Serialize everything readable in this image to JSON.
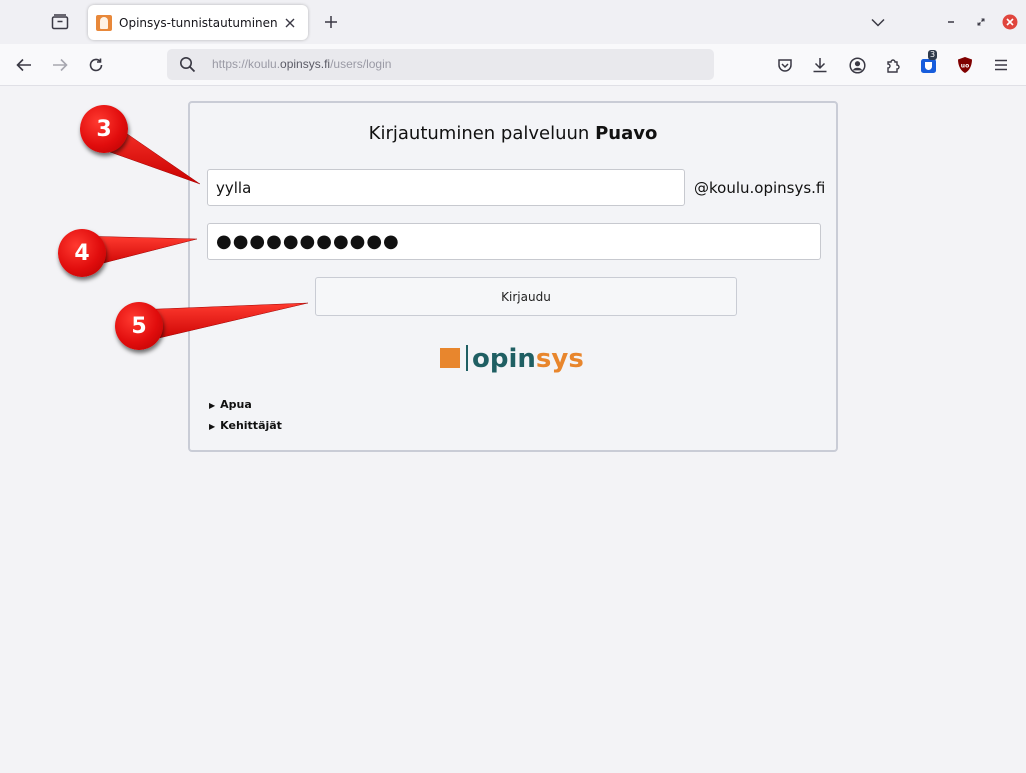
{
  "browser": {
    "tab_title": "Opinsys-tunnistautuminen",
    "url_prefix": "https://koulu.",
    "url_host": "opinsys.fi",
    "url_path": "/users/login",
    "extension_badge": "3"
  },
  "login": {
    "heading_prefix": "Kirjautuminen palveluun ",
    "heading_service": "Puavo",
    "username_value": "yylla",
    "domain_suffix": "@koulu.opinsys.fi",
    "password_mask": "●●●●●●●●●●●",
    "submit_label": "Kirjaudu",
    "logo_text_a": "opin",
    "logo_text_b": "sys",
    "help_link": "Apua",
    "developers_link": "Kehittäjät"
  },
  "annotations": {
    "step_user": "3",
    "step_password": "4",
    "step_submit": "5"
  },
  "colors": {
    "logo_orange": "#e8862d",
    "logo_teal": "#1f5f63",
    "annotation_red": "#e10d0d"
  }
}
